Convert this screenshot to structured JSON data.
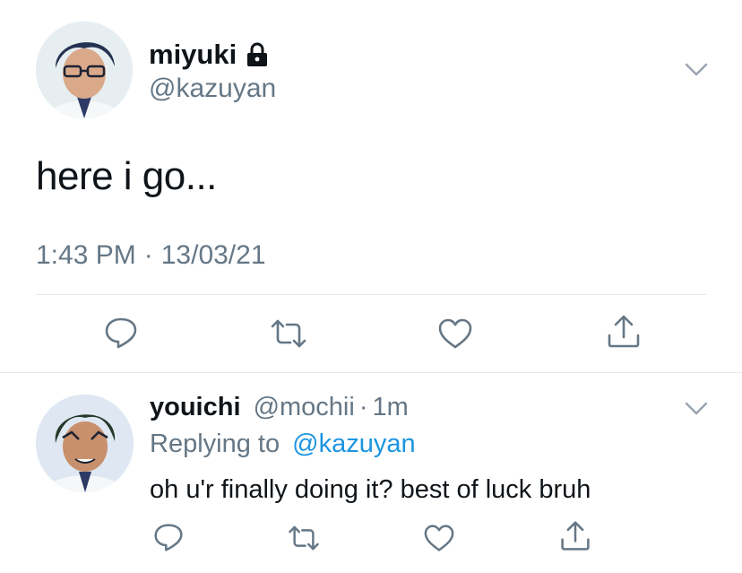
{
  "main_tweet": {
    "display_name": "miyuki",
    "handle": "@kazuyan",
    "locked_icon": "lock-icon",
    "text": "here i go...",
    "time": "1:43 PM",
    "separator": "·",
    "date": "13/03/21",
    "actions": [
      "reply-icon",
      "retweet-icon",
      "like-icon",
      "share-icon"
    ]
  },
  "reply": {
    "display_name": "youichi",
    "handle": "@mochii",
    "separator": "·",
    "age": "1m",
    "replying_label": "Replying to",
    "replying_handle": "@kazuyan",
    "text": "oh u'r finally doing it? best of luck bruh",
    "actions": [
      "reply-icon",
      "retweet-icon",
      "like-icon",
      "share-icon"
    ]
  },
  "colors": {
    "text": "#0f1419",
    "muted": "#657786",
    "link": "#1b95e0",
    "divider": "#e1e8ed"
  }
}
